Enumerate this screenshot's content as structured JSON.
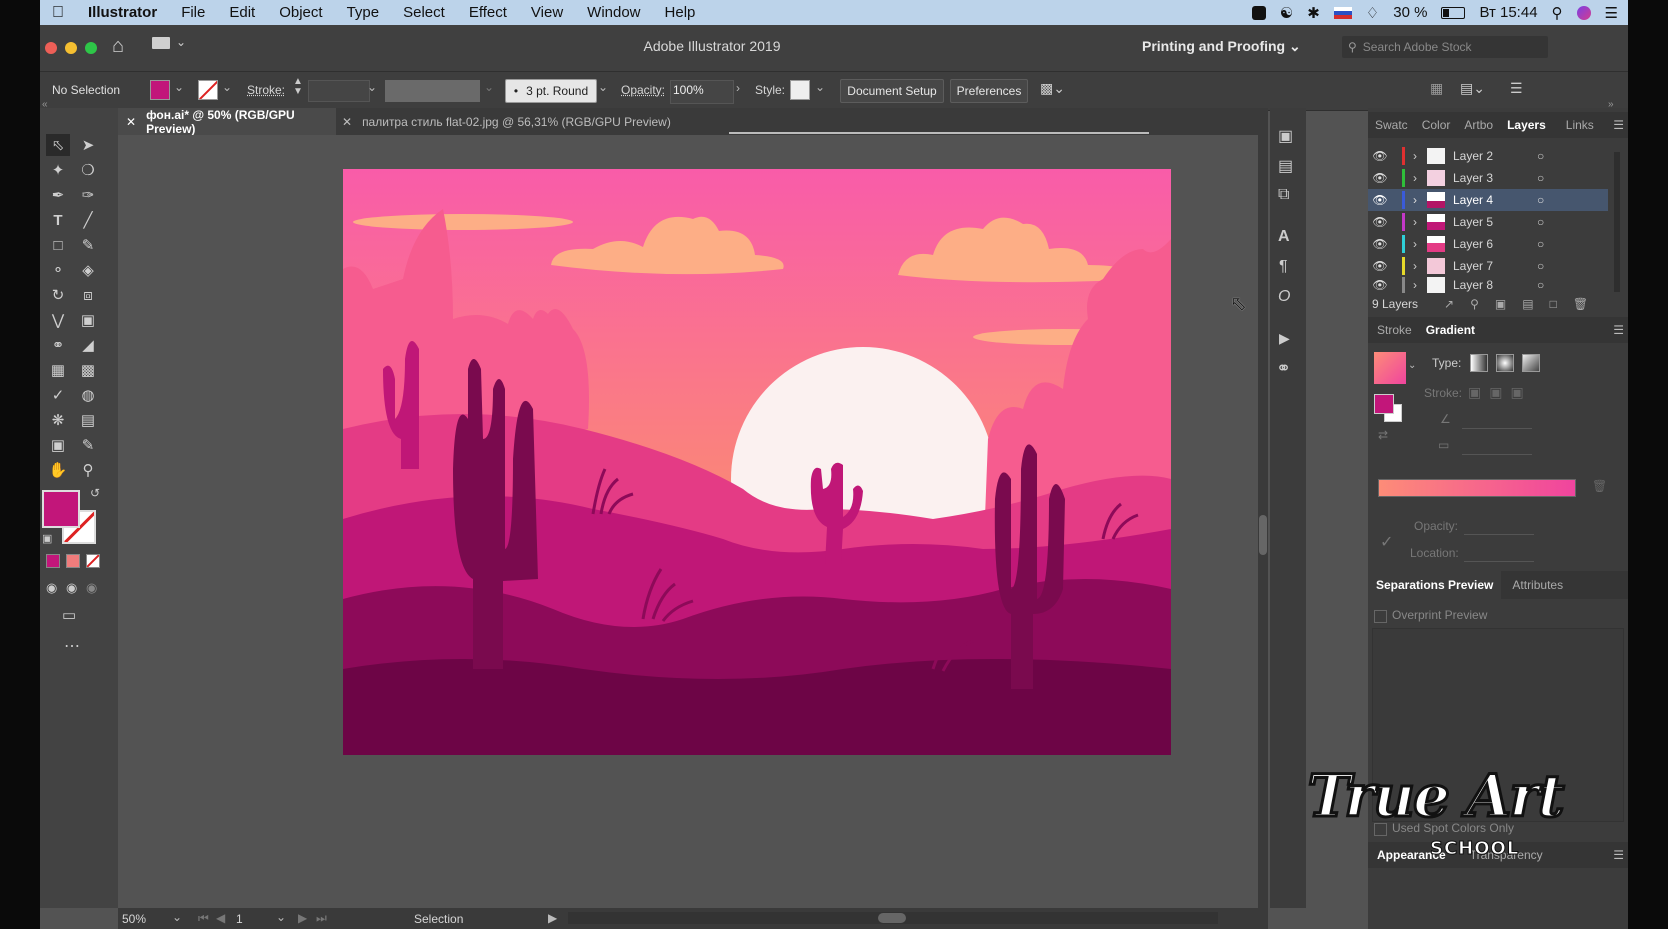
{
  "menubar": {
    "app_name": "Illustrator",
    "items": [
      "File",
      "Edit",
      "Object",
      "Type",
      "Select",
      "Effect",
      "View",
      "Window",
      "Help"
    ],
    "battery": "30 %",
    "clock": "Вт 15:44"
  },
  "window": {
    "title": "Adobe Illustrator 2019",
    "workspace": "Printing and Proofing",
    "search_placeholder": "Search Adobe Stock"
  },
  "controlbar": {
    "selection": "No Selection",
    "stroke_label": "Stroke:",
    "brush": "3 pt. Round",
    "opacity_label": "Opacity:",
    "opacity_value": "100%",
    "style_label": "Style:",
    "document_setup": "Document Setup",
    "preferences": "Preferences",
    "fill_color": "#c2167a"
  },
  "tabs": [
    {
      "label": "фон.ai* @ 50% (RGB/GPU Preview)",
      "active": true
    },
    {
      "label": "палитра стиль flat-02.jpg @ 56,31% (RGB/GPU Preview)",
      "active": false
    }
  ],
  "layers_panel": {
    "tabs": [
      "Swatc",
      "Color",
      "Artbo",
      "Layers",
      "Links"
    ],
    "active_tab": "Layers",
    "layers": [
      {
        "name": "Layer 2",
        "color": "#e03030",
        "selected": false
      },
      {
        "name": "Layer 3",
        "color": "#2fbf3a",
        "selected": false
      },
      {
        "name": "Layer 4",
        "color": "#3a5bd9",
        "selected": true
      },
      {
        "name": "Layer 5",
        "color": "#c438c8",
        "selected": false
      },
      {
        "name": "Layer 6",
        "color": "#2fd0d8",
        "selected": false
      },
      {
        "name": "Layer 7",
        "color": "#e6d92a",
        "selected": false
      },
      {
        "name": "Layer 8",
        "color": "#888888",
        "selected": false
      }
    ],
    "count": "9 Layers"
  },
  "gradient_panel": {
    "tabs": [
      "Stroke",
      "Gradient"
    ],
    "type_label": "Type:",
    "stroke_label": "Stroke:",
    "opacity_label": "Opacity:",
    "location_label": "Location:",
    "gradient_start": "#fd8c78",
    "gradient_end": "#f0449e"
  },
  "separations_panel": {
    "tabs": [
      "Separations Preview",
      "Attributes"
    ],
    "overprint": "Overprint Preview",
    "spot_colors": "Used Spot Colors Only"
  },
  "bottom_panel": {
    "tabs": [
      "Appearance",
      "Transparency"
    ]
  },
  "statusbar": {
    "zoom": "50%",
    "artboard": "1",
    "tool": "Selection"
  },
  "watermark": {
    "line1": "True Art",
    "line2": "SCHOOL"
  }
}
